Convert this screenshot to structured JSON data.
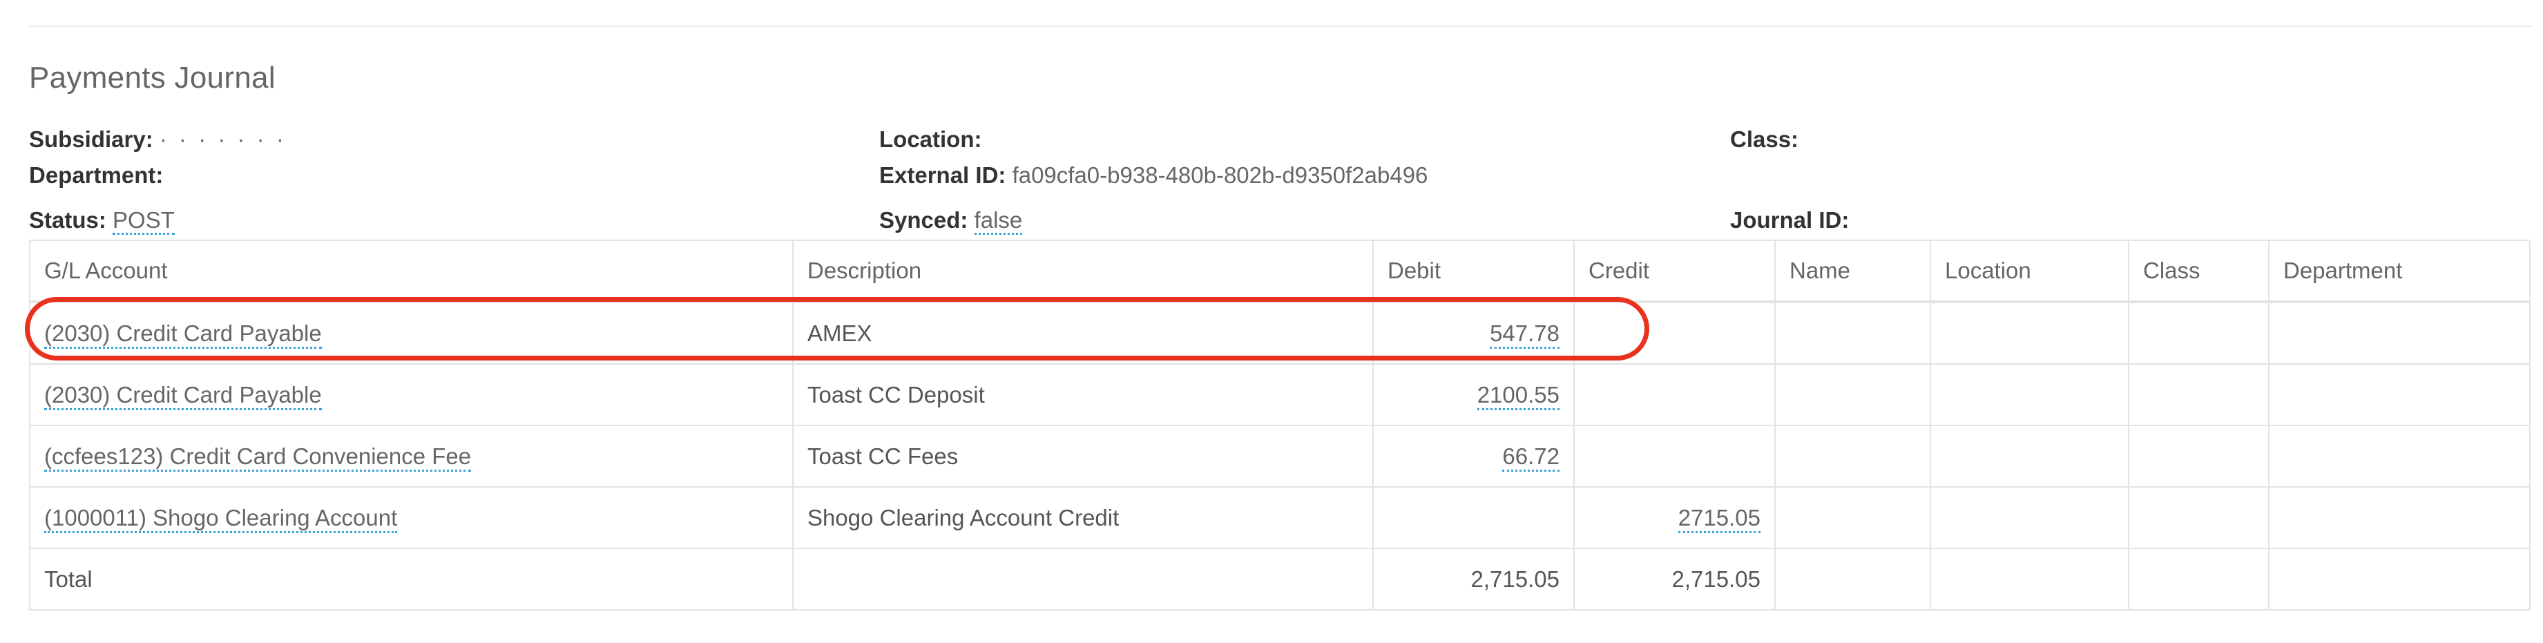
{
  "page": {
    "title": "Payments Journal"
  },
  "meta": {
    "subsidiary": {
      "label": "Subsidiary:",
      "value": "· ·   ·  ·  ·  ·   ·"
    },
    "department": {
      "label": "Department:",
      "value": ""
    },
    "status": {
      "label": "Status:",
      "value": "POST"
    },
    "location": {
      "label": "Location:",
      "value": ""
    },
    "external_id": {
      "label": "External ID:",
      "value": "fa09cfa0-b938-480b-802b-d9350f2ab496"
    },
    "synced": {
      "label": "Synced:",
      "value": "false"
    },
    "class": {
      "label": "Class:",
      "value": ""
    },
    "journal_id": {
      "label": "Journal ID:",
      "value": ""
    }
  },
  "table": {
    "headers": {
      "gl_account": "G/L Account",
      "description": "Description",
      "debit": "Debit",
      "credit": "Credit",
      "name": "Name",
      "location": "Location",
      "class": "Class",
      "department": "Department"
    },
    "rows": [
      {
        "gl_account": "(2030) Credit Card Payable",
        "description": "AMEX",
        "debit": "547.78",
        "credit": ""
      },
      {
        "gl_account": "(2030) Credit Card Payable",
        "description": "Toast CC Deposit",
        "debit": "2100.55",
        "credit": ""
      },
      {
        "gl_account": "(ccfees123) Credit Card Convenience Fee",
        "description": "Toast CC Fees",
        "debit": "66.72",
        "credit": ""
      },
      {
        "gl_account": "(1000011) Shogo Clearing Account",
        "description": "Shogo Clearing Account Credit",
        "debit": "",
        "credit": "2715.05"
      }
    ],
    "total": {
      "label": "Total",
      "debit": "2,715.05",
      "credit": "2,715.05"
    }
  },
  "colors": {
    "highlight_ring": "#e8321e",
    "link_underline": "#3aa0d8"
  }
}
